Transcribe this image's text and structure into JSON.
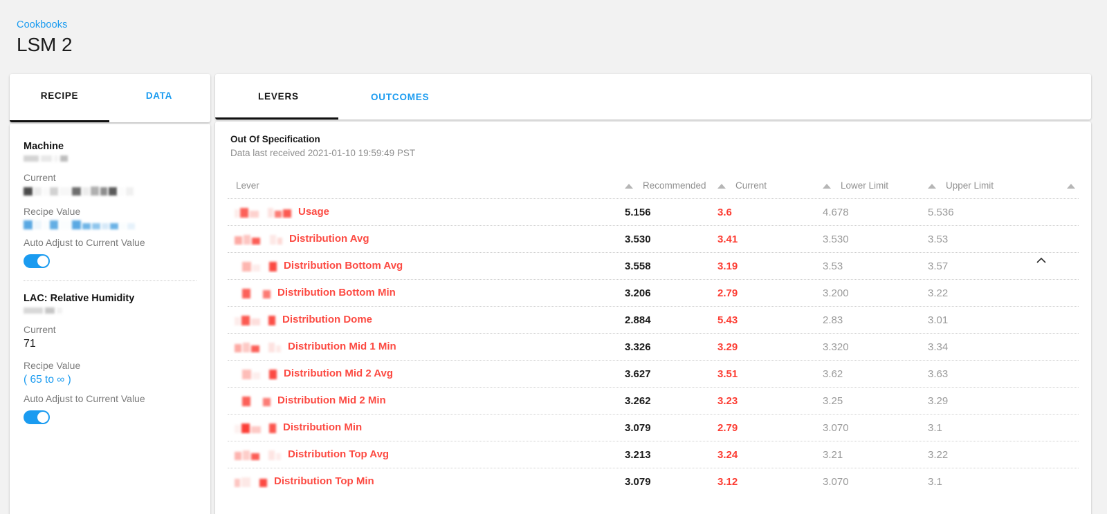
{
  "header": {
    "breadcrumb": "Cookbooks",
    "title": "LSM 2"
  },
  "left_panel": {
    "tabs": [
      {
        "label": "RECIPE",
        "active": true
      },
      {
        "label": "DATA",
        "active": false
      }
    ],
    "levers": [
      {
        "name": "Machine",
        "subtitle_redacted": true,
        "current_label": "Current",
        "current_value_redacted": true,
        "recipe_label": "Recipe Value",
        "recipe_value_redacted": true,
        "auto_adjust_label": "Auto Adjust to Current Value",
        "auto_adjust_on": true
      },
      {
        "name": "LAC: Relative Humidity",
        "subtitle_redacted": true,
        "current_label": "Current",
        "current_value": "71",
        "recipe_label": "Recipe Value",
        "recipe_value": "( 65 to ∞ )",
        "auto_adjust_label": "Auto Adjust to Current Value",
        "auto_adjust_on": true
      }
    ]
  },
  "right_panel": {
    "tabs": [
      {
        "label": "LEVERS",
        "active": true
      },
      {
        "label": "OUTCOMES",
        "active": false
      }
    ],
    "section": {
      "title": "Out Of Specification",
      "subtitle": "Data last received 2021-01-10 19:59:49 PST",
      "collapse_icon": "chevron-up-icon"
    },
    "table": {
      "columns": [
        "Lever",
        "Recommended",
        "Current",
        "Lower Limit",
        "Upper Limit"
      ],
      "rows": [
        {
          "lever": "Usage",
          "recommended": "5.156",
          "current": "3.6",
          "lower_limit": "4.678",
          "upper_limit": "5.536"
        },
        {
          "lever": "Distribution Avg",
          "recommended": "3.530",
          "current": "3.41",
          "lower_limit": "3.530",
          "upper_limit": "3.53"
        },
        {
          "lever": "Distribution Bottom Avg",
          "recommended": "3.558",
          "current": "3.19",
          "lower_limit": "3.53",
          "upper_limit": "3.57"
        },
        {
          "lever": "Distribution Bottom Min",
          "recommended": "3.206",
          "current": "2.79",
          "lower_limit": "3.200",
          "upper_limit": "3.22"
        },
        {
          "lever": "Distribution Dome",
          "recommended": "2.884",
          "current": "5.43",
          "lower_limit": "2.83",
          "upper_limit": "3.01"
        },
        {
          "lever": "Distribution Mid 1 Min",
          "recommended": "3.326",
          "current": "3.29",
          "lower_limit": "3.320",
          "upper_limit": "3.34"
        },
        {
          "lever": "Distribution Mid 2 Avg",
          "recommended": "3.627",
          "current": "3.51",
          "lower_limit": "3.62",
          "upper_limit": "3.63"
        },
        {
          "lever": "Distribution Mid 2 Min",
          "recommended": "3.262",
          "current": "3.23",
          "lower_limit": "3.25",
          "upper_limit": "3.29"
        },
        {
          "lever": "Distribution Min",
          "recommended": "3.079",
          "current": "2.79",
          "lower_limit": "3.070",
          "upper_limit": "3.1"
        },
        {
          "lever": "Distribution Top Avg",
          "recommended": "3.213",
          "current": "3.24",
          "lower_limit": "3.21",
          "upper_limit": "3.22"
        },
        {
          "lever": "Distribution Top Min",
          "recommended": "3.079",
          "current": "3.12",
          "lower_limit": "3.070",
          "upper_limit": "3.1"
        }
      ]
    }
  },
  "colors": {
    "accent_blue": "#1a9bf0",
    "alert_red": "#fc4a42",
    "page_bg": "#f2f2f2",
    "muted_text": "#909090"
  }
}
